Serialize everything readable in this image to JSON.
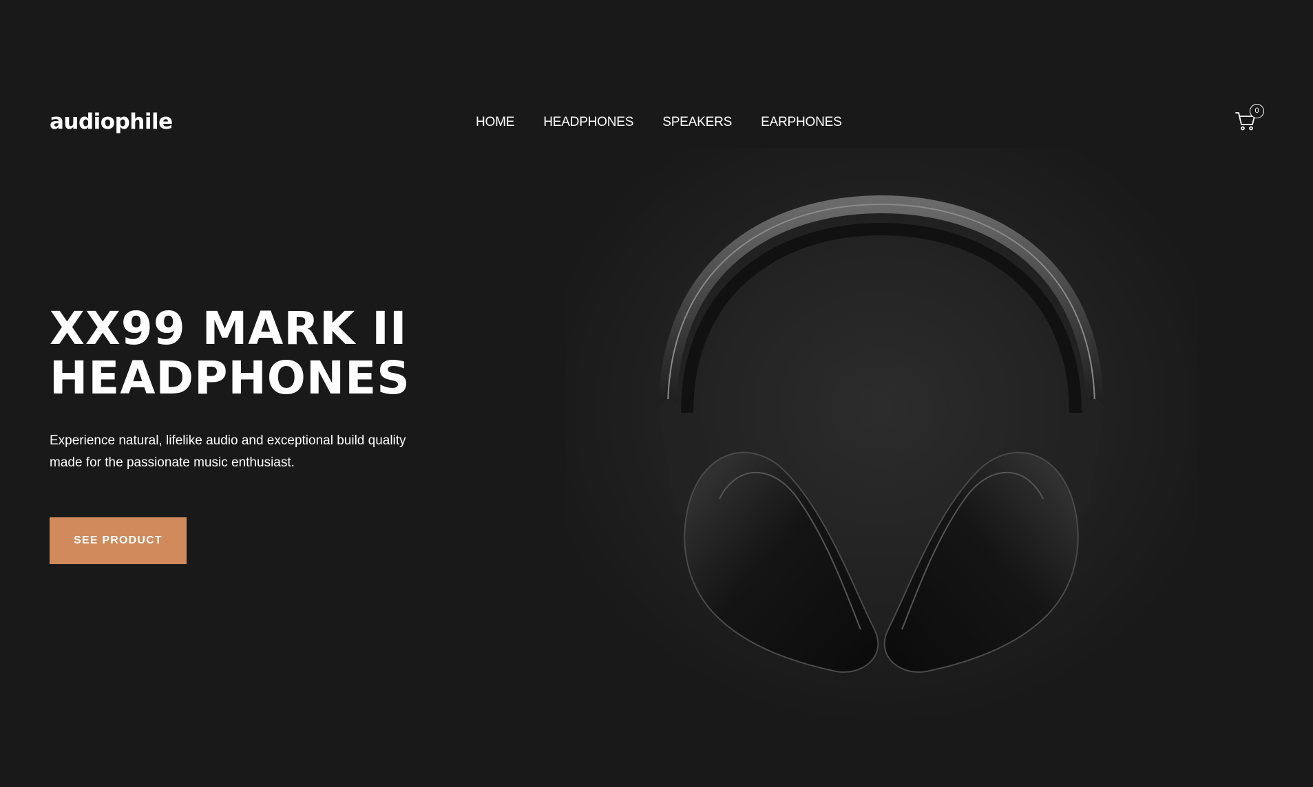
{
  "header": {
    "logo": "audiophile",
    "nav": [
      {
        "label": "HOME"
      },
      {
        "label": "HEADPHONES"
      },
      {
        "label": "SPEAKERS"
      },
      {
        "label": "EARPHONES"
      }
    ],
    "cart": {
      "icon": "cart-icon",
      "count": "0"
    }
  },
  "hero": {
    "title_line1": "XX99 MARK II",
    "title_line2": "HEADPHONES",
    "description": "Experience natural, lifelike audio and exceptional build quality made for the passionate music enthusiast.",
    "cta_label": "SEE PRODUCT",
    "image": "headphones-image"
  },
  "colors": {
    "background": "#191919",
    "accent": "#d08a5c",
    "text": "#ffffff"
  }
}
